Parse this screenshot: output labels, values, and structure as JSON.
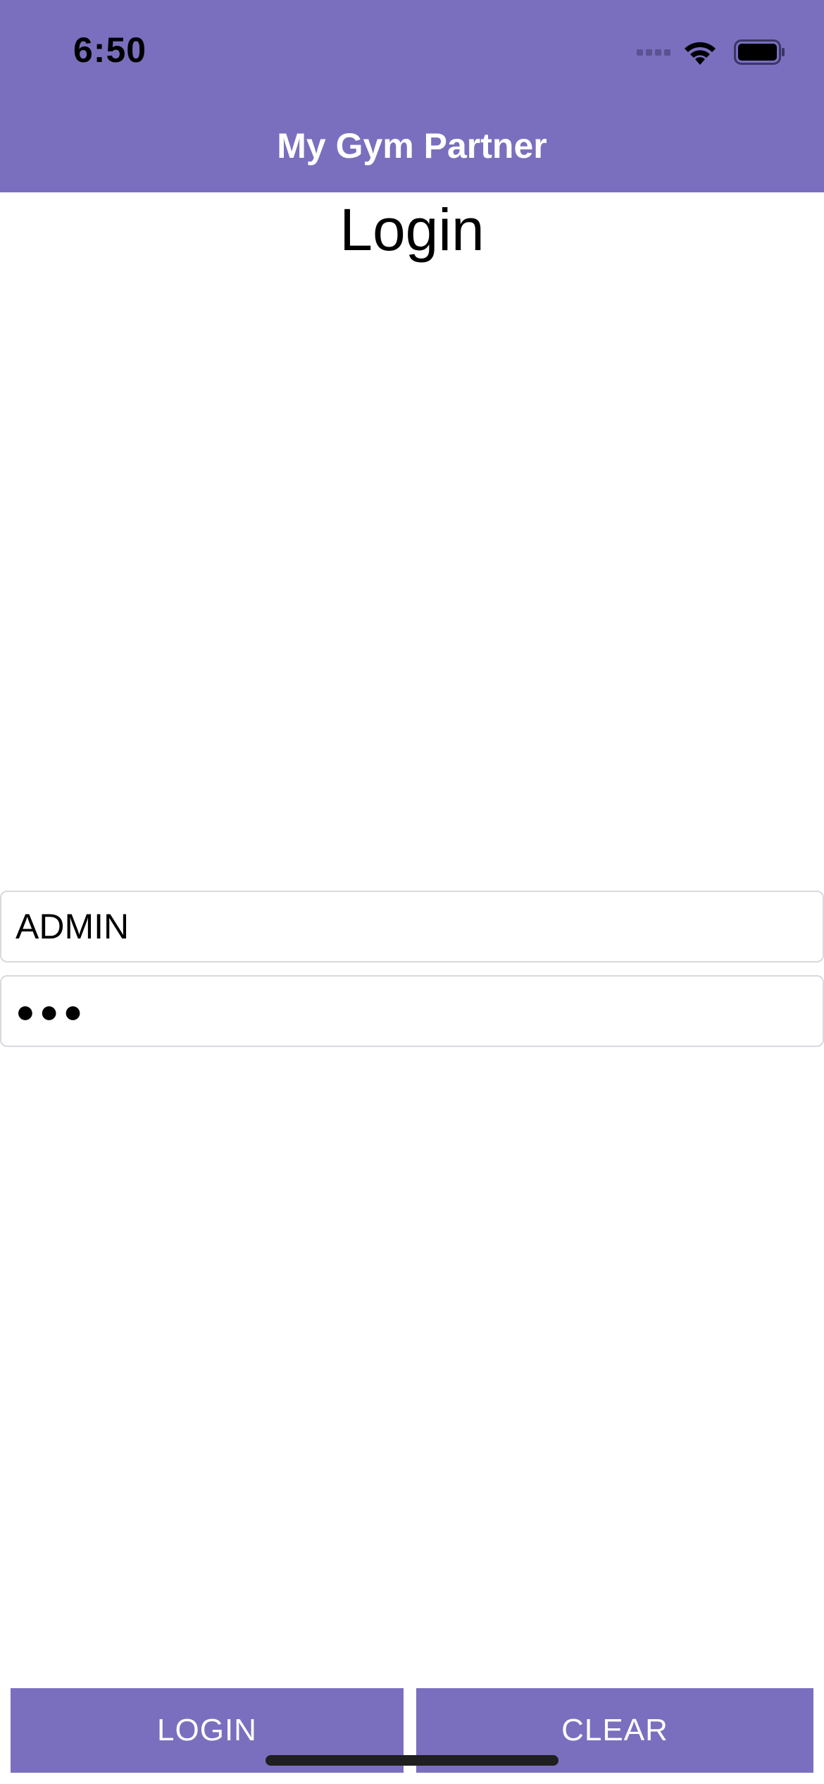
{
  "status_bar": {
    "time": "6:50"
  },
  "nav": {
    "title": "My Gym Partner"
  },
  "page": {
    "title": "Login"
  },
  "form": {
    "username_value": "ADMIN",
    "password_value": "●●●"
  },
  "buttons": {
    "login_label": "LOGIN",
    "clear_label": "CLEAR"
  },
  "colors": {
    "accent": "#7a6fbe",
    "text_on_accent": "#ffffff"
  },
  "icons": {
    "signal": "cellular-signal-icon",
    "wifi": "wifi-icon",
    "battery": "battery-icon"
  }
}
